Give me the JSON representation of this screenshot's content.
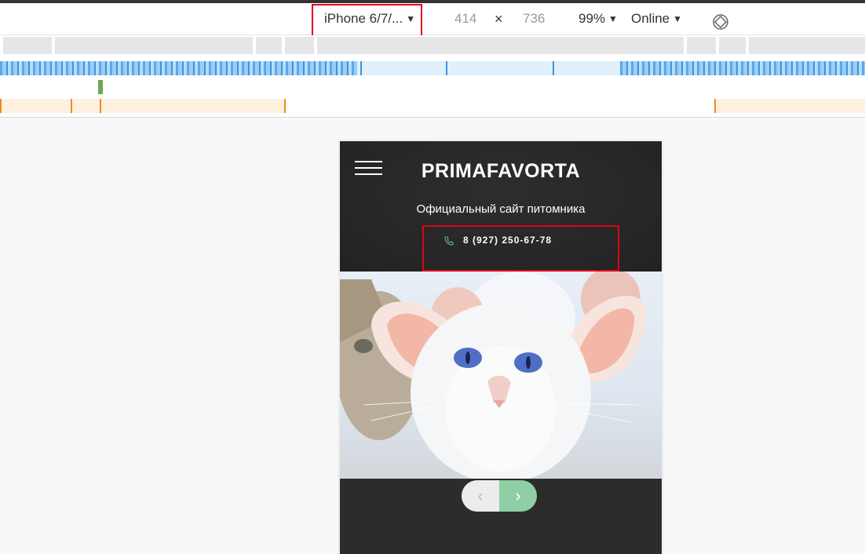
{
  "toolbar": {
    "device": "iPhone 6/7/...",
    "width": "414",
    "times": "×",
    "height": "736",
    "zoom": "99%",
    "network": "Online",
    "caret": "▼"
  },
  "site": {
    "brand": "PRIMAFAVORTA",
    "subtitle": "Официальный сайт питомника",
    "phone": "8 (927) 250-67-78",
    "prev_glyph": "‹",
    "next_glyph": "›"
  },
  "colors": {
    "highlight": "#e0001b",
    "accent_green": "#8fcfa6",
    "header_bg": "#222222"
  },
  "icons": [
    "device-caret-icon",
    "rotate-icon",
    "phone-icon",
    "hamburger-menu-icon",
    "chevron-left-icon",
    "chevron-right-icon"
  ]
}
